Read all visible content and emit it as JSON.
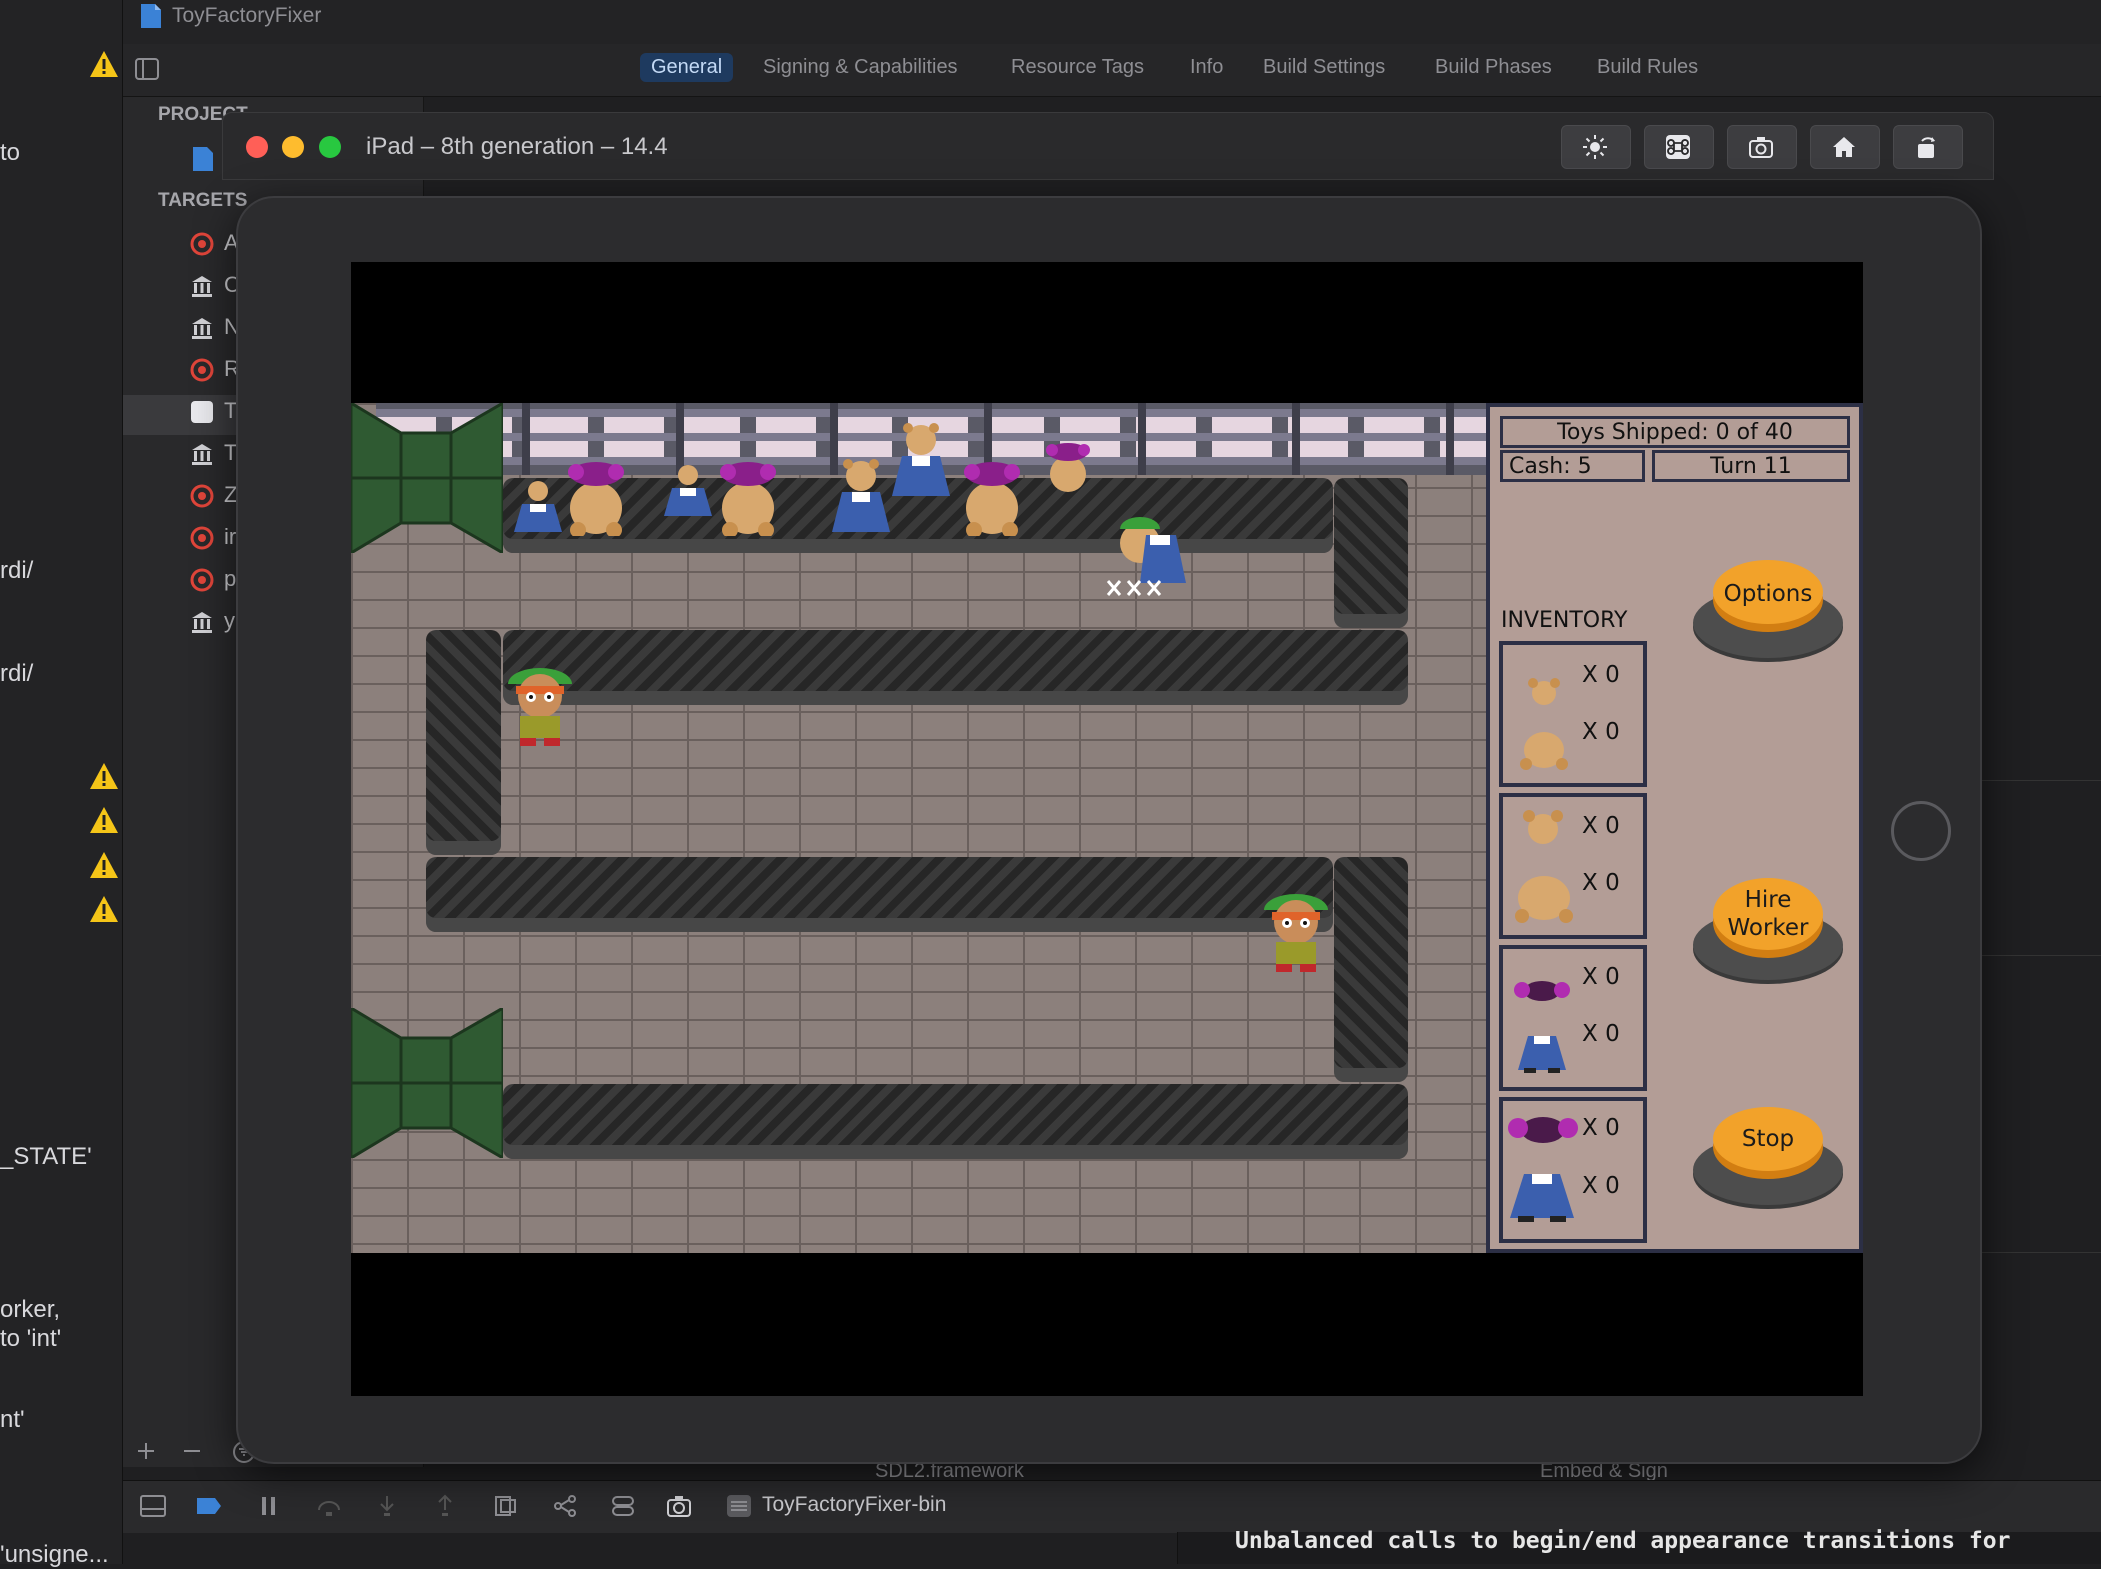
{
  "xcode": {
    "project_title": "ToyFactoryFixer",
    "tabs": [
      "General",
      "Signing & Capabilities",
      "Resource Tags",
      "Info",
      "Build Settings",
      "Build Phases",
      "Build Rules"
    ],
    "navigator": {
      "project_header": "PROJECT",
      "targets_header": "TARGETS",
      "items": [
        "A",
        "C",
        "N",
        "R",
        "T",
        "T",
        "Z",
        "ir",
        "p",
        "y"
      ]
    },
    "issue_snippets": [
      "to",
      "rdi/",
      "rdi/",
      "_STATE'",
      "orker,",
      "to 'int'",
      "nt'",
      "'unsigne..."
    ],
    "framework_label": "SDL2.framework",
    "embed_label": "Embed & Sign",
    "scheme": "ToyFactoryFixer-bin",
    "console_line": "Unbalanced calls to begin/end appearance transitions for"
  },
  "simulator": {
    "title": "iPad – 8th generation – 14.4",
    "toolbar_icons": [
      "brightness-icon",
      "command-icon",
      "screenshot-icon",
      "home-icon",
      "rotate-icon"
    ]
  },
  "game": {
    "toys_shipped": "Toys Shipped: 0 of 40",
    "cash": "Cash: 5",
    "turn": "Turn 11",
    "inventory_title": "INVENTORY",
    "inventory_counts": [
      "X 0",
      "X 0",
      "X 0",
      "X 0",
      "X 0",
      "X 0",
      "X 0",
      "X 0"
    ],
    "buttons": {
      "options": "Options",
      "hire_line1": "Hire",
      "hire_line2": "Worker",
      "stop": "Stop"
    }
  },
  "colors": {
    "accent_tab": "#1e3a5f",
    "panel_bg": "#b39d96",
    "panel_border": "#2c2f45",
    "button_orange": "#f2a22a",
    "warning_yellow": "#f5c518",
    "target_red": "#e0453a"
  }
}
